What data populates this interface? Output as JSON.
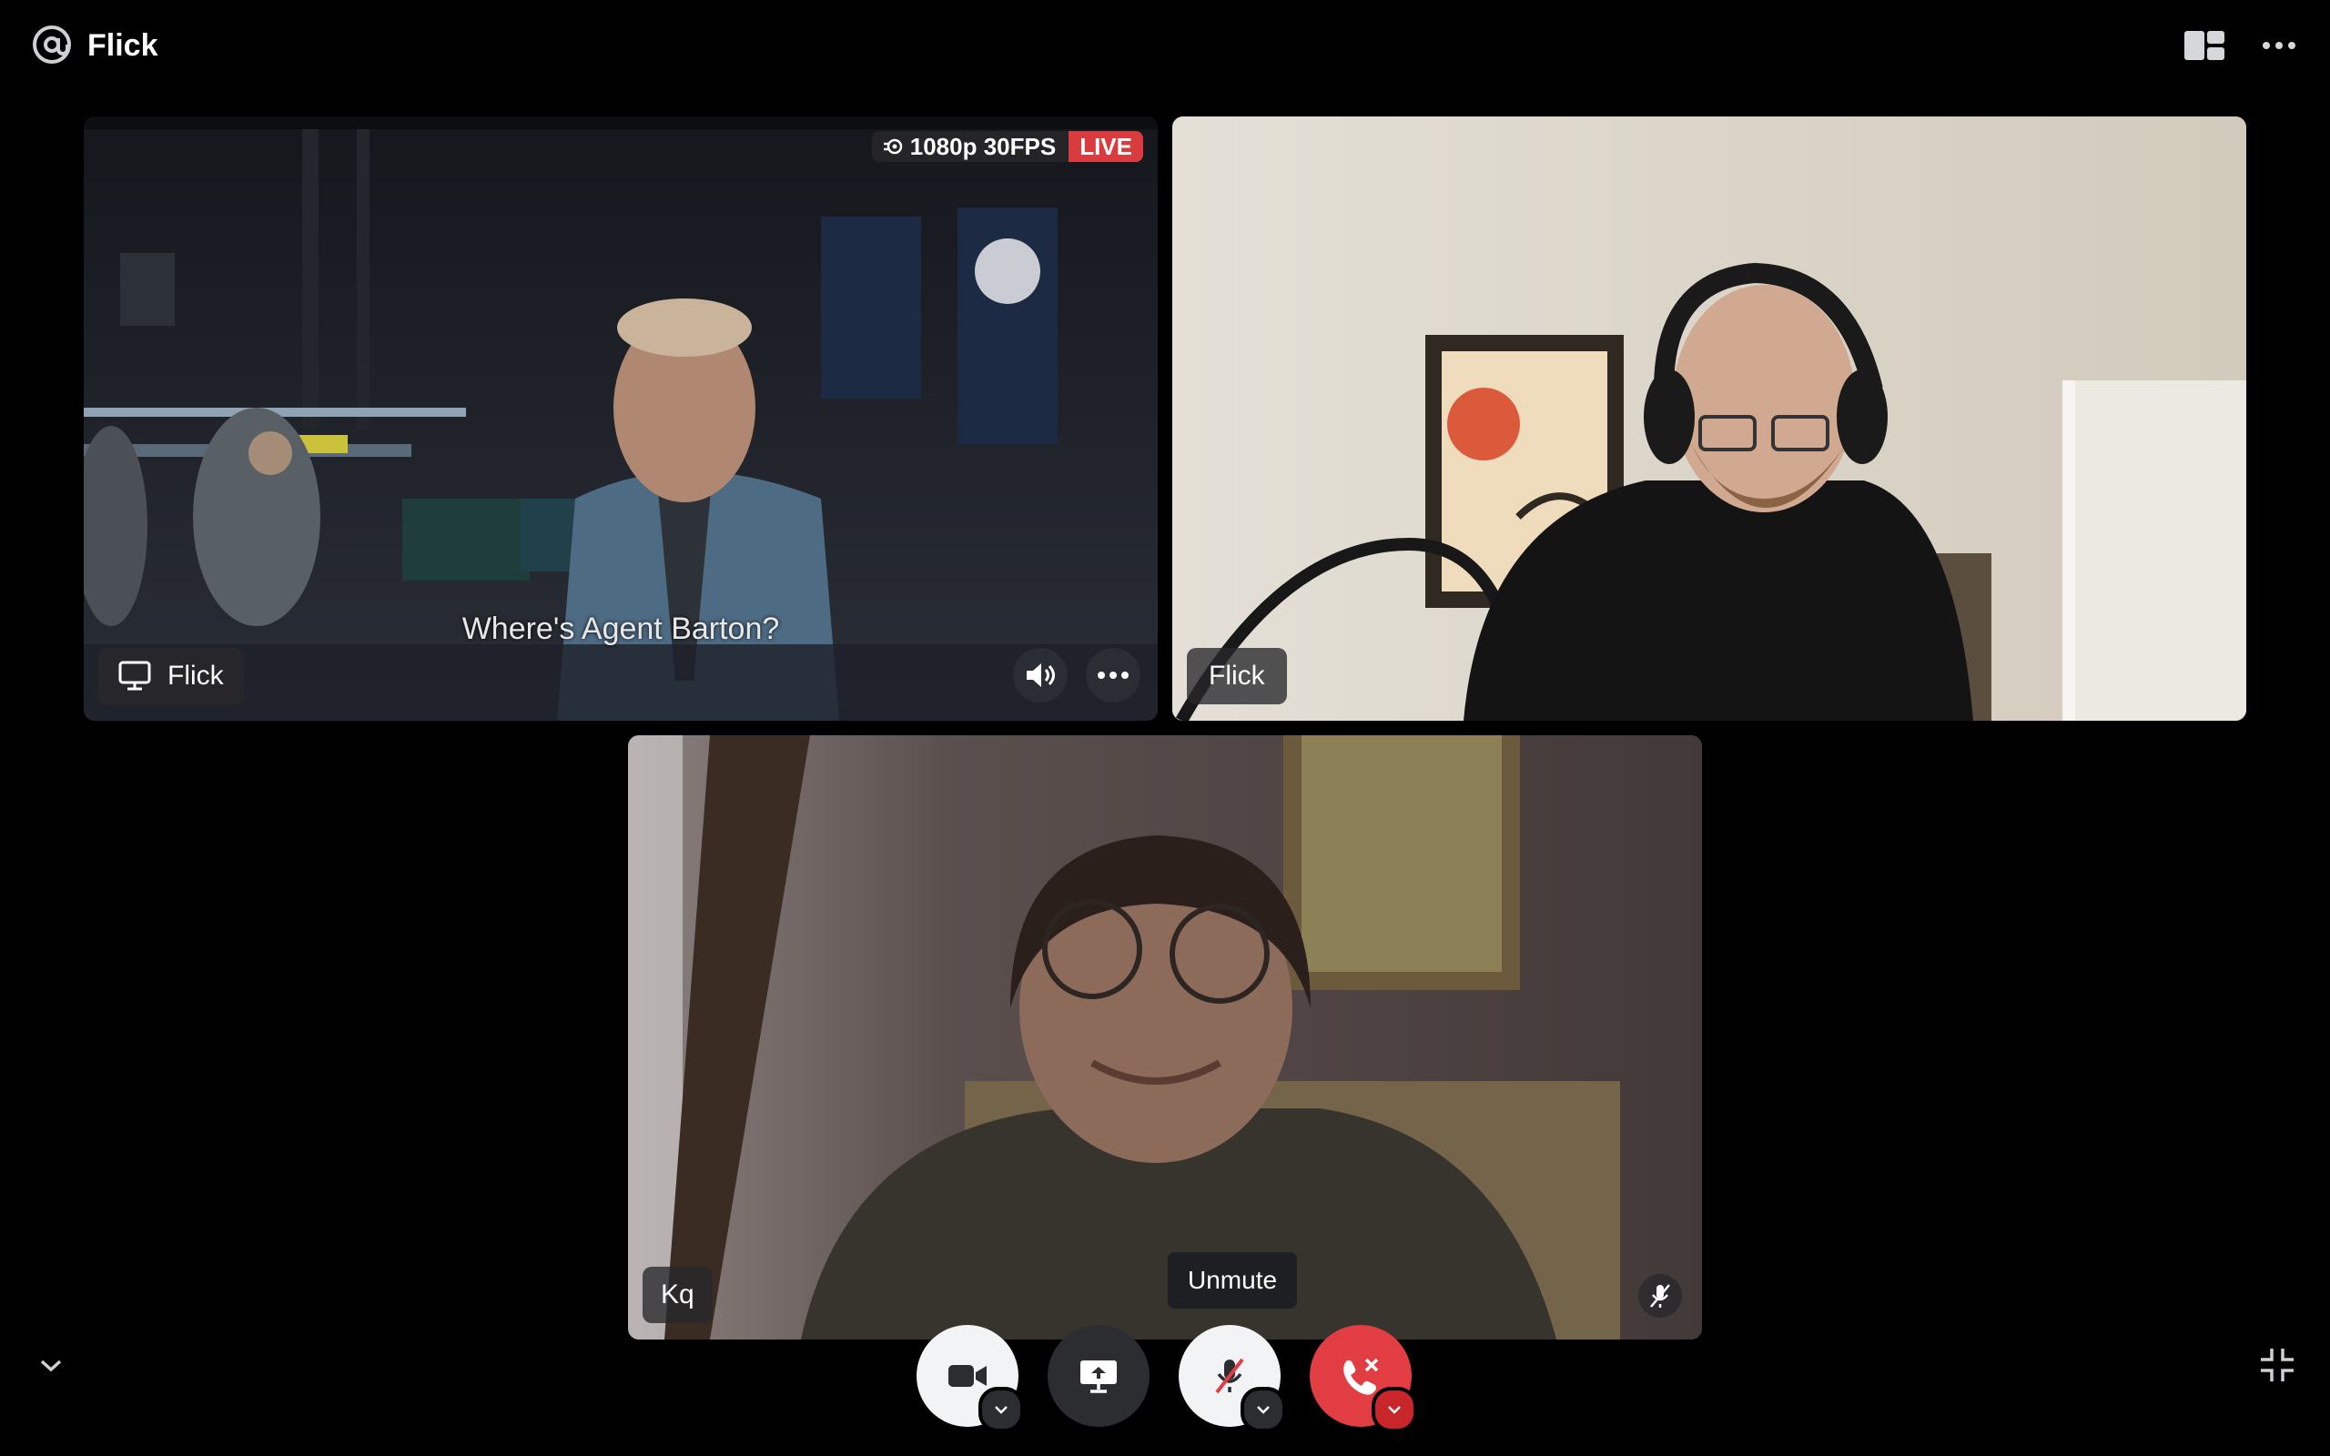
{
  "header": {
    "channel_name": "Flick",
    "channel_icon": "at-sign-icon",
    "layout_icon": "grid-layout-icon",
    "more_icon": "more-dots-icon"
  },
  "stream_tile": {
    "quality": "1080p 30FPS",
    "live_label": "LIVE",
    "subtitle": "Where's Agent Barton?",
    "name": "Flick",
    "live_color": "#d83c3e"
  },
  "flick_tile": {
    "name": "Flick"
  },
  "kq_tile": {
    "name": "Kq",
    "muted": true
  },
  "controls": {
    "tooltip": "Unmute",
    "hangup_color": "#e23d42"
  }
}
